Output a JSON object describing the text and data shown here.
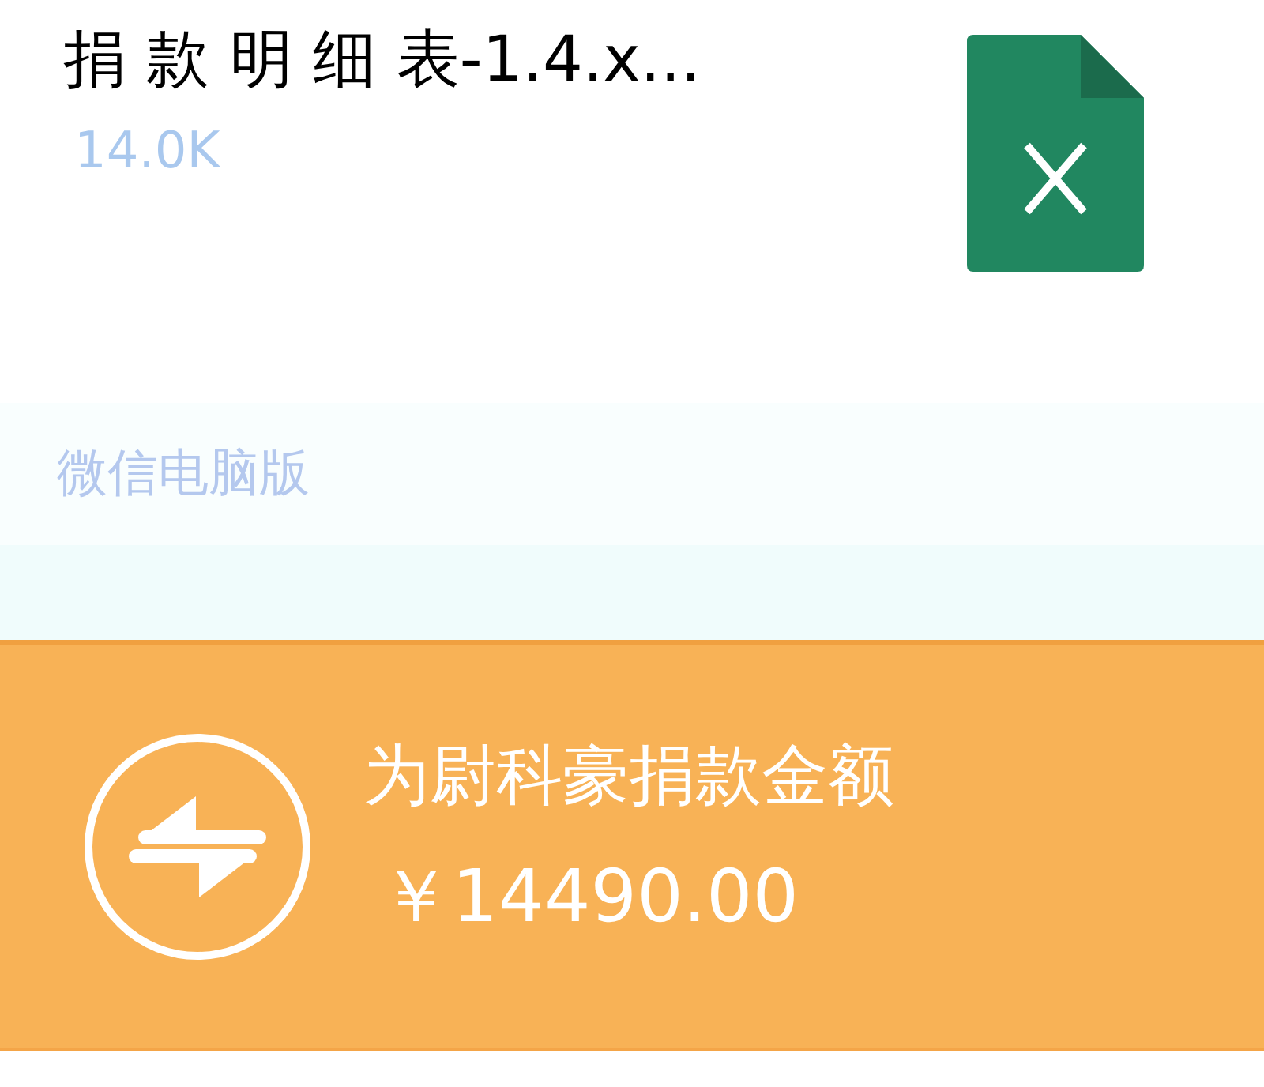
{
  "file_message": {
    "file_name": "捐 款 明 细 表-1.4.x...",
    "file_size": "14.0K",
    "source": "微信电脑版"
  },
  "transfer_message": {
    "title": "为尉科豪捐款金额",
    "amount": "￥14490.00"
  }
}
